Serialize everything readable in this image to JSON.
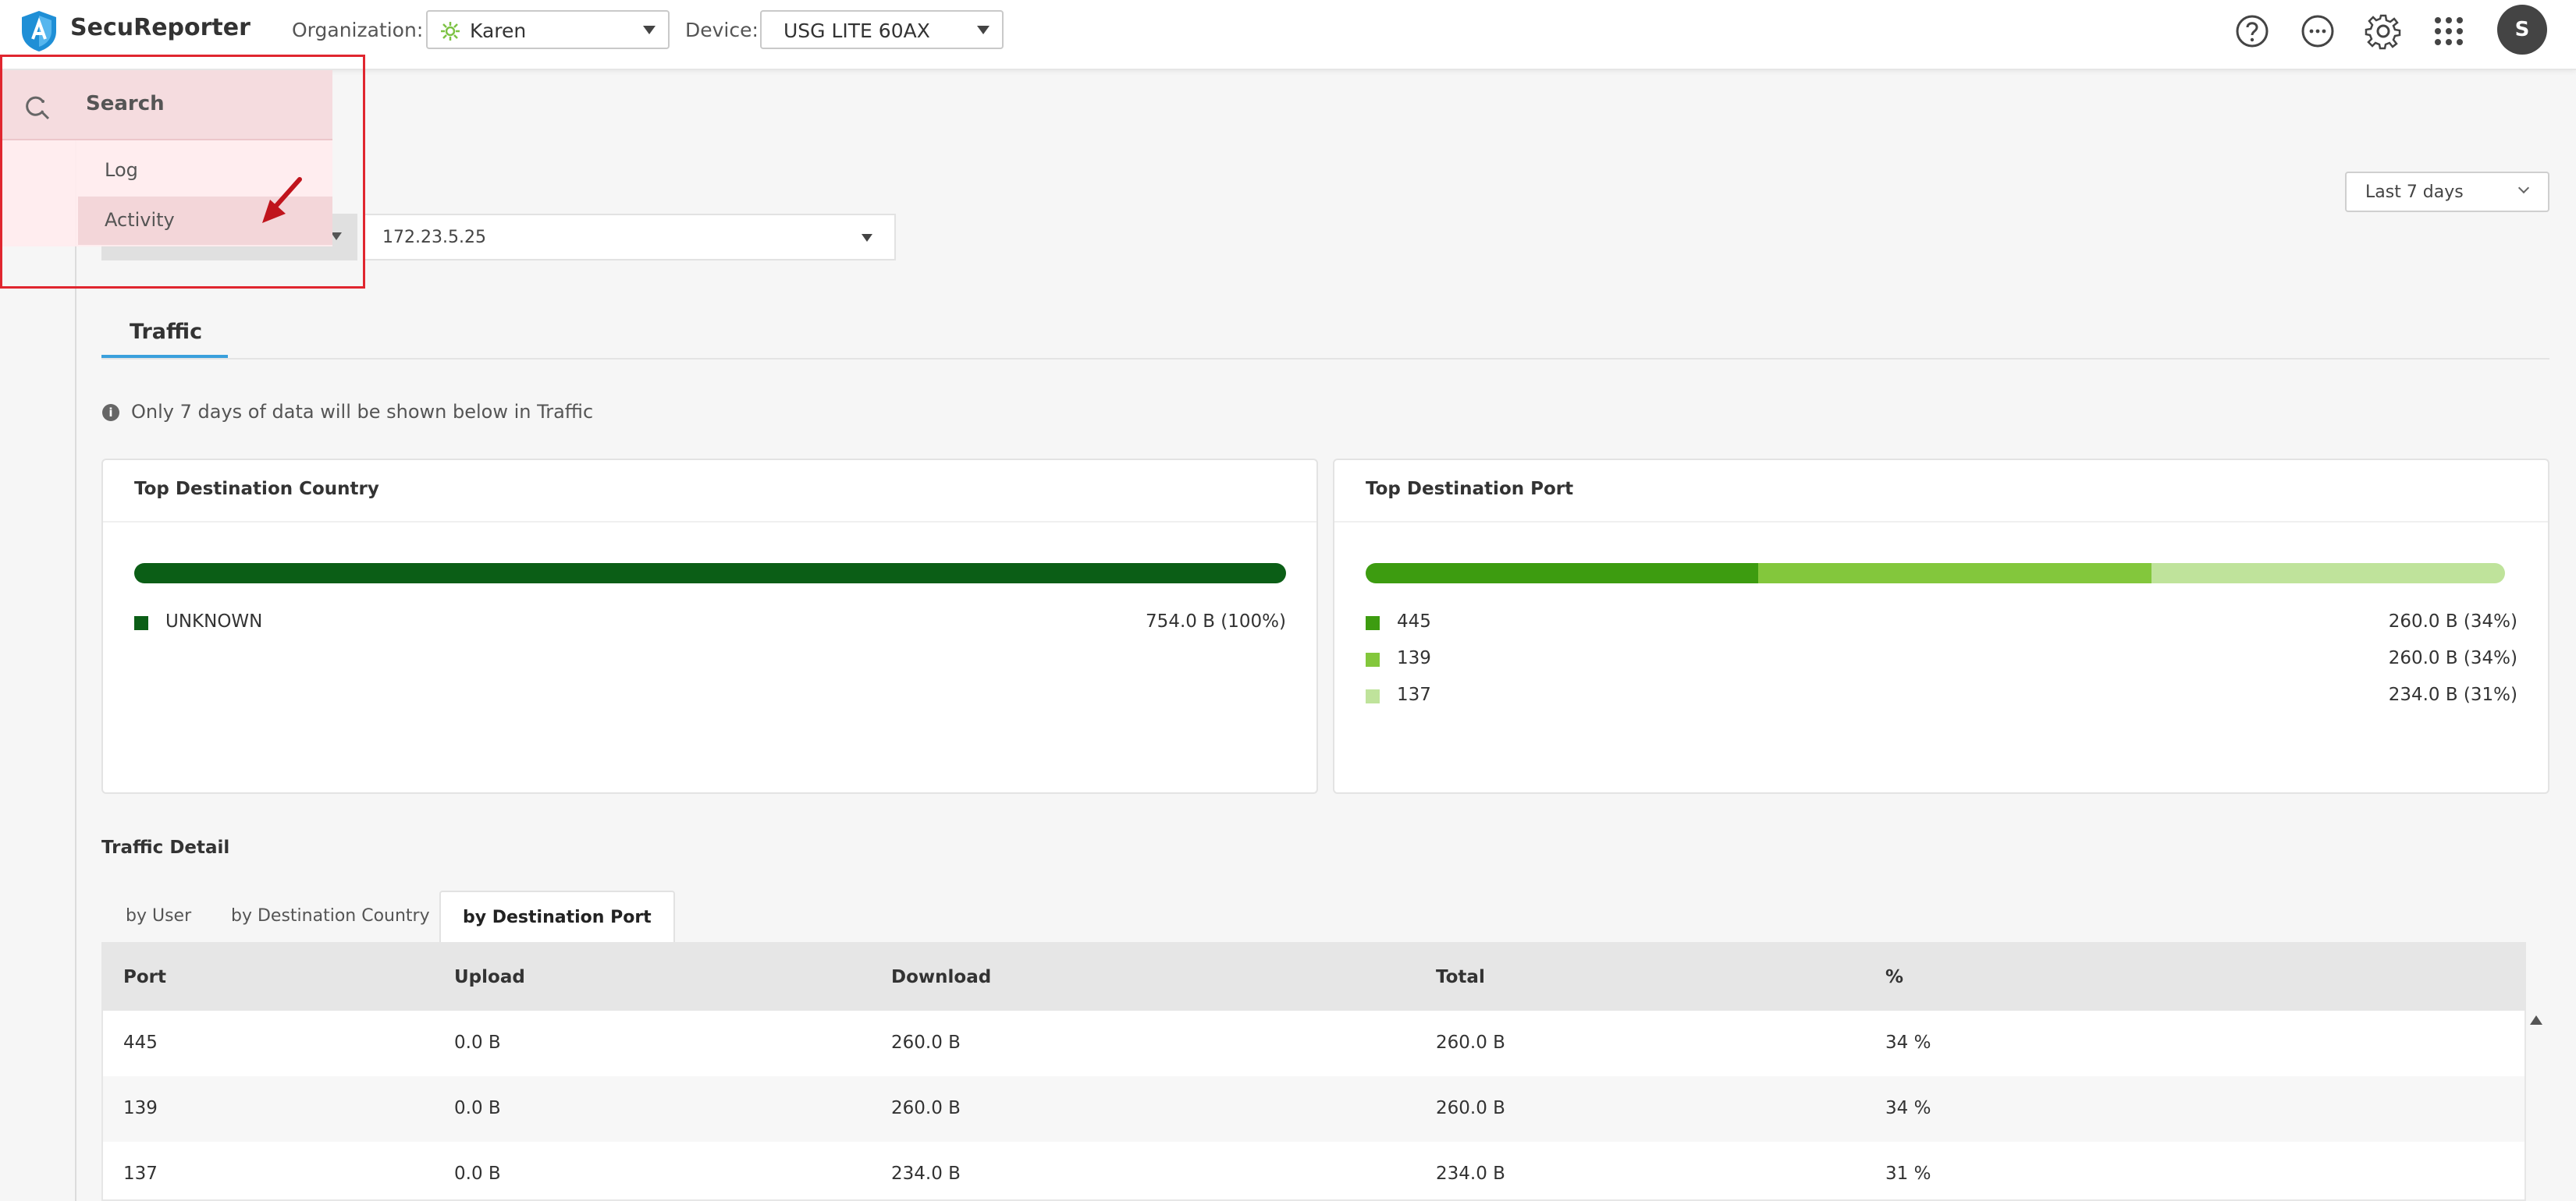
{
  "app": {
    "title": "SecuReporter",
    "avatar_initial": "S"
  },
  "header": {
    "org_label": "Organization:",
    "org_value": "Karen",
    "device_label": "Device:",
    "device_value": "USG LITE 60AX",
    "icons": [
      "help-icon",
      "more-icon",
      "gear-icon",
      "apps-grid-icon"
    ]
  },
  "search_menu": {
    "placeholder": "Search",
    "items": [
      {
        "label": "Log"
      },
      {
        "label": "Activity"
      }
    ]
  },
  "filters": {
    "time_range": "Last 7 days",
    "ip_value": "172.23.5.25"
  },
  "tabs": {
    "traffic": "Traffic"
  },
  "info_text": "Only 7 days of data will be shown below in Traffic",
  "top_destination_country": {
    "title": "Top Destination Country",
    "colors": [
      "#0b5e16"
    ],
    "chart_data": {
      "type": "bar",
      "categories": [
        "UNKNOWN"
      ],
      "values": [
        754.0
      ],
      "labels": [
        "754.0 B (100%)"
      ],
      "percent": [
        100
      ]
    }
  },
  "top_destination_port": {
    "title": "Top Destination Port",
    "colors": [
      "#3d9c10",
      "#83c73c",
      "#bfe39b"
    ],
    "chart_data": {
      "type": "bar",
      "categories": [
        "445",
        "139",
        "137"
      ],
      "values": [
        260.0,
        260.0,
        234.0
      ],
      "labels": [
        "260.0 B (34%)",
        "260.0 B (34%)",
        "234.0 B (31%)"
      ],
      "percent": [
        34,
        34,
        31
      ]
    }
  },
  "traffic_detail": {
    "title": "Traffic Detail",
    "tabs": [
      "by User",
      "by Destination Country",
      "by Destination Port"
    ],
    "active_tab": 2,
    "columns": [
      "Port",
      "Upload",
      "Download",
      "Total",
      "%"
    ],
    "rows": [
      [
        "445",
        "0.0 B",
        "260.0 B",
        "260.0 B",
        "34 %"
      ],
      [
        "139",
        "0.0 B",
        "260.0 B",
        "260.0 B",
        "34 %"
      ],
      [
        "137",
        "0.0 B",
        "234.0 B",
        "234.0 B",
        "31 %"
      ]
    ]
  }
}
